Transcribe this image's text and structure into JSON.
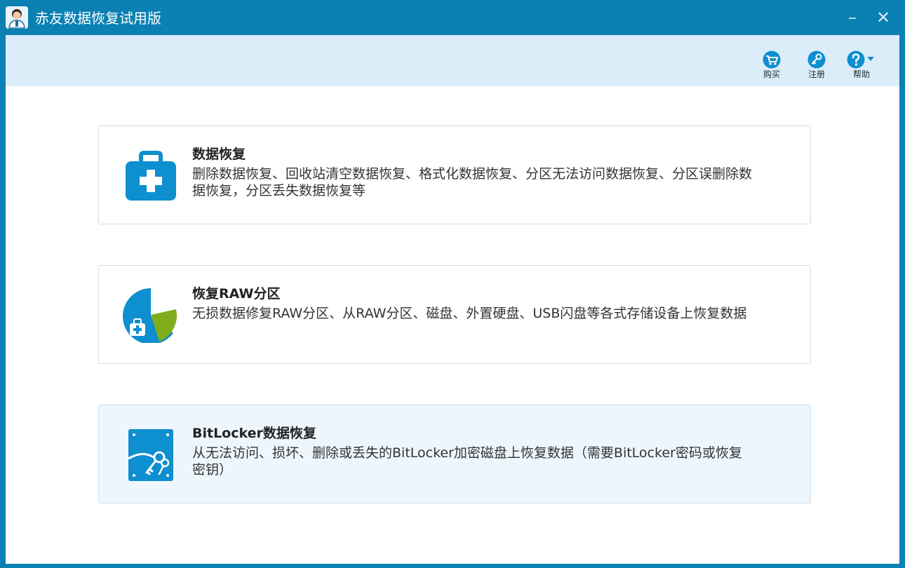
{
  "window": {
    "title": "赤友数据恢复试用版",
    "minimize_glyph": "–",
    "close_glyph": "✕"
  },
  "toolbar": {
    "buy_label": "购买",
    "register_label": "注册",
    "help_label": "帮助",
    "buy_icon": "cart-icon",
    "register_icon": "key-icon",
    "help_icon": "question-icon"
  },
  "cards": [
    {
      "title": "数据恢复",
      "description": "删除数据恢复、回收站清空数据恢复、格式化数据恢复、分区无法访问数据恢复、分区误删除数据恢复，分区丢失数据恢复等",
      "icon": "first-aid-kit-icon"
    },
    {
      "title": "恢复RAW分区",
      "description": "无损数据修复RAW分区、从RAW分区、磁盘、外置硬盘、USB闪盘等各式存储设备上恢复数据",
      "icon": "pie-partition-icon"
    },
    {
      "title": "BitLocker数据恢复",
      "description": "从无法访问、损坏、删除或丢失的BitLocker加密磁盘上恢复数据（需要BitLocker密码或恢复密钥）",
      "icon": "encrypted-disk-key-icon"
    }
  ],
  "colors": {
    "titlebar": "#0b80b2",
    "toolbar": "#dcedfa",
    "accent": "#0d8fd0",
    "green": "#7fae1c",
    "active_card": "#eef6fd"
  }
}
